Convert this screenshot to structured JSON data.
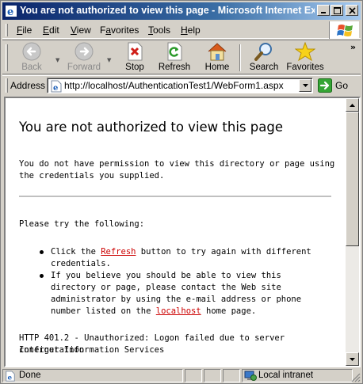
{
  "window": {
    "title": "You are not authorized to view this page - Microsoft Internet Exp..."
  },
  "menu": {
    "items": [
      {
        "u": "F",
        "rest": "ile"
      },
      {
        "u": "E",
        "rest": "dit"
      },
      {
        "u": "V",
        "rest": "iew"
      },
      {
        "u": "",
        "pre": "F",
        "mid": "a",
        "rest": "vorites"
      },
      {
        "u": "T",
        "rest": "ools"
      },
      {
        "u": "H",
        "rest": "elp"
      }
    ]
  },
  "toolbar": {
    "back": "Back",
    "forward": "Forward",
    "stop": "Stop",
    "refresh": "Refresh",
    "home": "Home",
    "search": "Search",
    "favorites": "Favorites",
    "more": "»"
  },
  "address": {
    "label": "Address",
    "url": "http://localhost/AuthenticationTest1/WebForm1.aspx",
    "go": "Go"
  },
  "page": {
    "heading": "You are not authorized to view this page",
    "intro": "You do not have permission to view this directory or page using the credentials you supplied.",
    "try_following": "Please try the following:",
    "bullet1_pre": "Click the ",
    "bullet1_link": "Refresh",
    "bullet1_post": " button to try again with different credentials.",
    "bullet2_pre": "If you believe you should be able to view this directory or page, please contact the Web site administrator by using the e-mail address or phone number listed on the ",
    "bullet2_link": "localhost",
    "bullet2_post": " home page.",
    "error_line1": "HTTP 401.2 - Unauthorized: Logon failed due to server configuration",
    "error_line2": "Internet Information Services"
  },
  "status": {
    "text": "Done",
    "zone": "Local intranet"
  },
  "colors": {
    "titlebar_start": "#0a246a",
    "link": "#cc0000",
    "chrome": "#d4d0c8"
  }
}
